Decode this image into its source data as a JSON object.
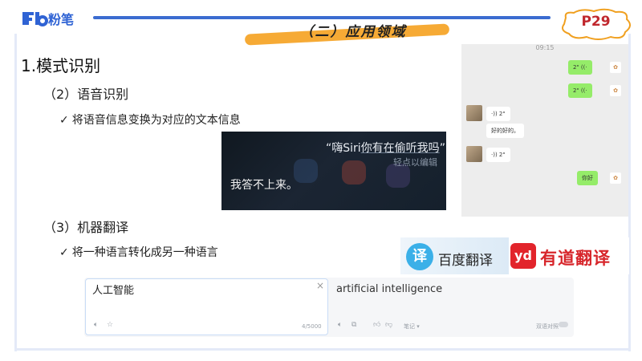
{
  "header": {
    "logo_text": "Fb 粉笔",
    "section_title": "（二）应用领域",
    "page_number": "P29",
    "accent": "#3b6cd0",
    "highlight": "#f5a52a"
  },
  "content": {
    "heading": "1.模式识别",
    "speech": {
      "title": "（2）语音识别",
      "bullet": "将语音信息变换为对应的文本信息"
    },
    "mt": {
      "title": "（3）机器翻译",
      "bullet": "将一种语言转化成另一种语言"
    },
    "check_glyph": "✓"
  },
  "siri": {
    "quote_prefix": "“嗨Siri",
    "quote_highlight": "你有在偷听我吗",
    "quote_suffix": "”",
    "hint": "轻点以编辑",
    "answer": "我答不上来。"
  },
  "chat": {
    "time": "09:15",
    "messages": [
      {
        "side": "right",
        "text": "2\" ((·"
      },
      {
        "side": "right",
        "text": "2\" ((·"
      },
      {
        "side": "left",
        "text": "·)) 2\"",
        "caption": "好的好的。"
      },
      {
        "side": "left",
        "text": "·)) 2\""
      },
      {
        "side": "right",
        "text": "你好"
      }
    ],
    "bubble_green": "#95ec69"
  },
  "translators": {
    "baidu_icon": "译",
    "baidu_name": "百度翻译",
    "youdao_icon": "yd",
    "youdao_name": "有道翻译"
  },
  "translate_panel": {
    "source_text": "人工智能",
    "close": "×",
    "char_count": "4/5000",
    "target_text": "artificial intelligence",
    "notes_label": "笔记",
    "compare_label": "双语对照"
  }
}
